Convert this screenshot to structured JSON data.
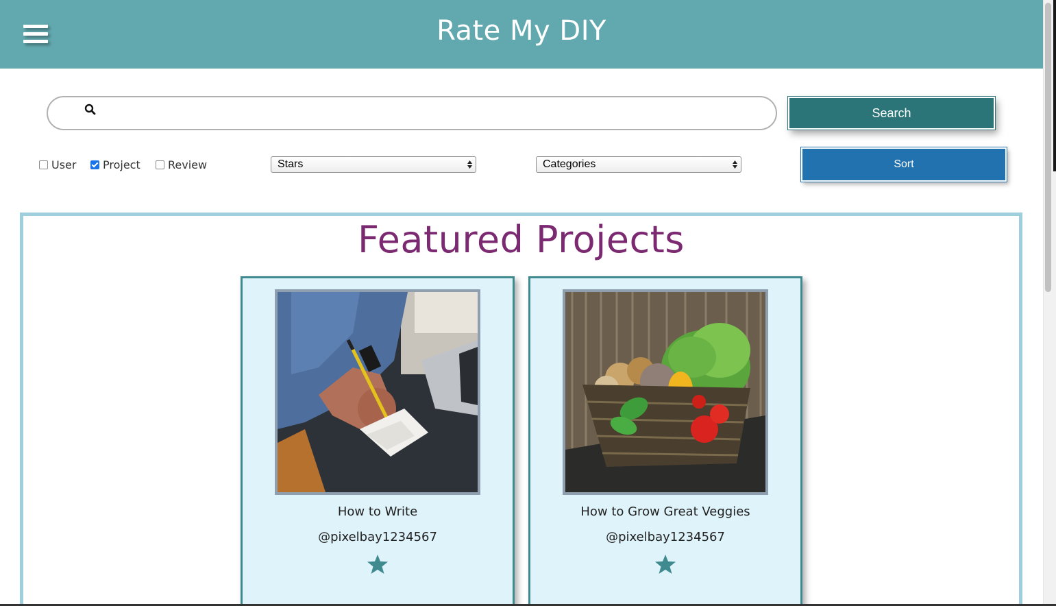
{
  "header": {
    "title": "Rate My DIY",
    "menu_icon": "hamburger-menu-icon",
    "background_color": "#62a9af"
  },
  "search": {
    "placeholder": "",
    "value": "",
    "icon": "search-icon",
    "button_label": "Search",
    "button_color": "#2b7579"
  },
  "filters": {
    "checkboxes": [
      {
        "label": "User",
        "checked": false
      },
      {
        "label": "Project",
        "checked": true
      },
      {
        "label": "Review",
        "checked": false
      }
    ],
    "stars_select": {
      "selected": "Stars"
    },
    "categories_select": {
      "selected": "Categories"
    },
    "sort_button_label": "Sort",
    "sort_button_color": "#2372b0"
  },
  "featured": {
    "title": "Featured Projects",
    "title_color": "#7b2a72",
    "projects": [
      {
        "title": "How to Write",
        "user": "@pixelbay1234567",
        "stars": 1,
        "star_icon": "star-icon"
      },
      {
        "title": "How to Grow Great Veggies",
        "user": "@pixelbay1234567",
        "stars": 1,
        "star_icon": "star-icon"
      }
    ]
  }
}
